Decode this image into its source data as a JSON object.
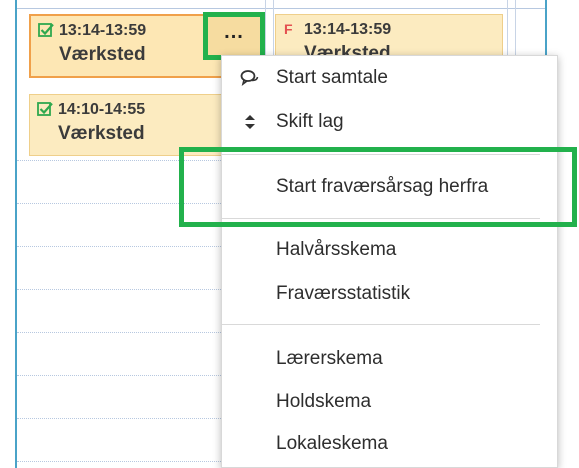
{
  "calendar": {
    "events": [
      {
        "time": "13:14-13:59",
        "place": "Værksted",
        "status": "checked"
      },
      {
        "time": "14:10-14:55",
        "place": "Værksted",
        "status": "checked"
      },
      {
        "time": "13:14-13:59",
        "place": "Værksted",
        "status": "flagged"
      }
    ],
    "more_button_label": "..."
  },
  "menu": {
    "items": [
      {
        "label": "Start samtale",
        "icon": "chat-bubbles-icon"
      },
      {
        "label": "Skift lag",
        "icon": "sort-arrows-icon"
      },
      {
        "label": "Start fraværsårsag herfra"
      },
      {
        "label": "Halvårsskema"
      },
      {
        "label": "Fraværsstatistik"
      },
      {
        "label": "Lærerskema"
      },
      {
        "label": "Holdskema"
      },
      {
        "label": "Lokaleskema"
      }
    ]
  },
  "colors": {
    "event_bg": "#fcebc0",
    "event_active_border": "#f0a04a",
    "check_green": "#2fa84f",
    "flag_red": "#e45050",
    "highlight_green": "#22b14c",
    "frame_blue": "#4aa3c8"
  }
}
